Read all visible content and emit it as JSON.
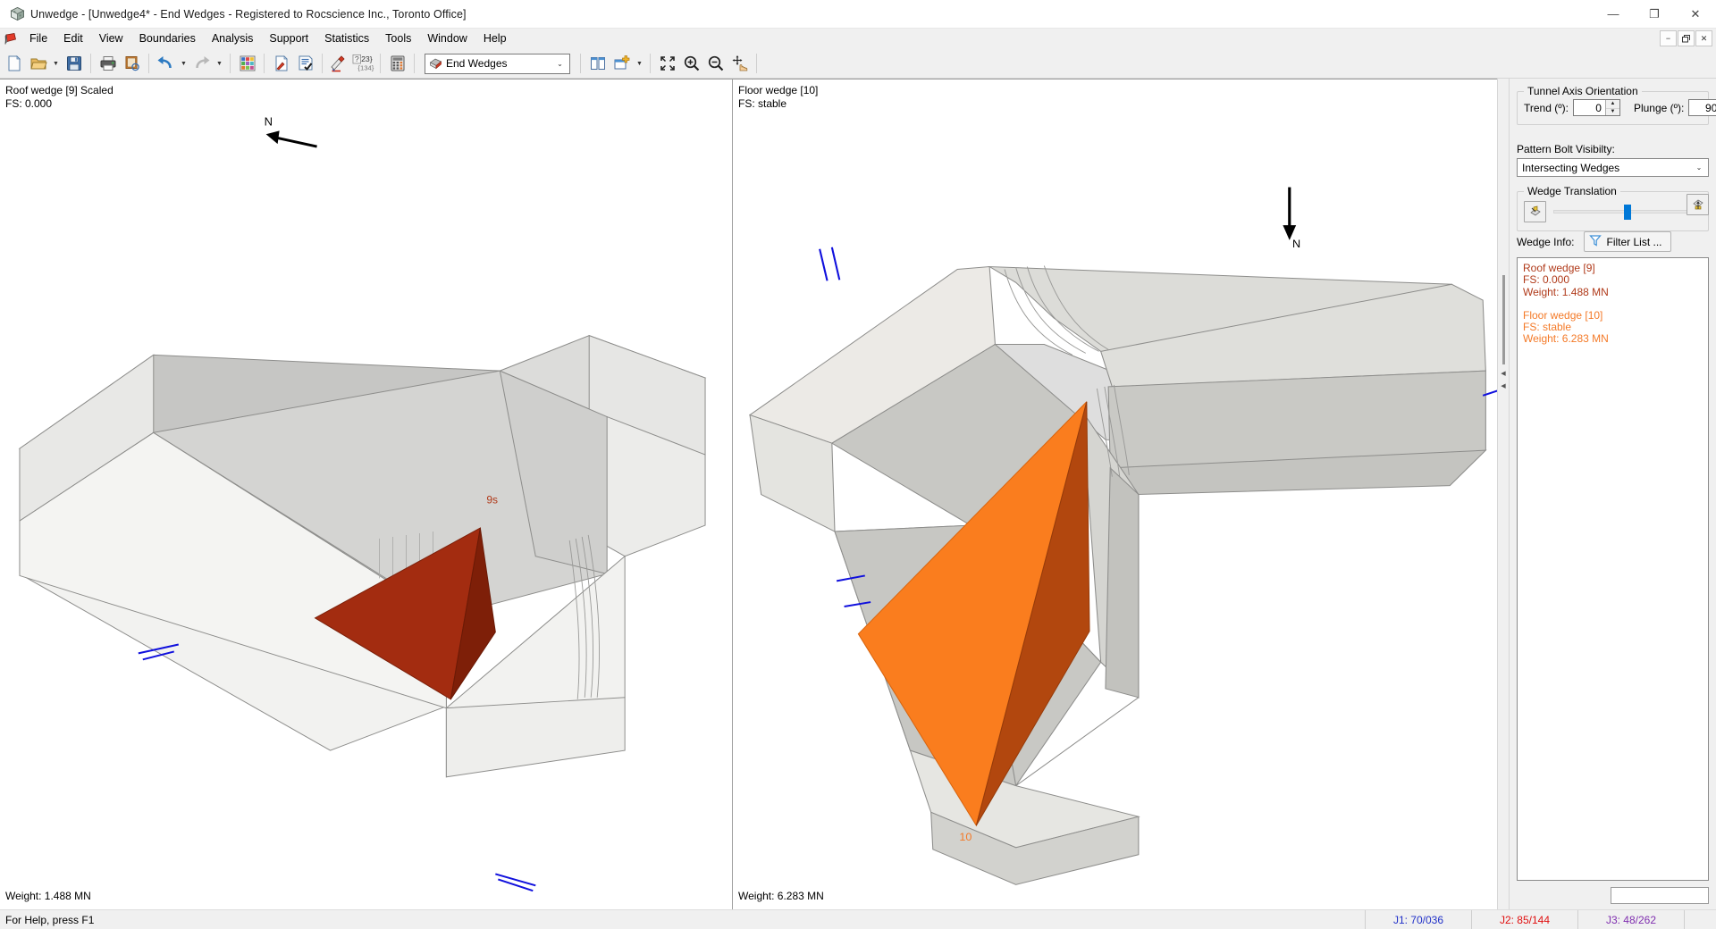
{
  "window": {
    "title": "Unwedge - [Unwedge4* - End Wedges - Registered to Rocscience Inc., Toronto Office]",
    "app_icon": "unwedge-cube-icon",
    "minimize_label": "—",
    "maximize_label": "❐",
    "close_label": "✕",
    "mdi_restore_label": "−",
    "mdi_maximize_label": "❐",
    "mdi_close_label": "✕"
  },
  "menu": {
    "items": [
      {
        "label": "File"
      },
      {
        "label": "Edit"
      },
      {
        "label": "View"
      },
      {
        "label": "Boundaries"
      },
      {
        "label": "Analysis"
      },
      {
        "label": "Support"
      },
      {
        "label": "Statistics"
      },
      {
        "label": "Tools"
      },
      {
        "label": "Window"
      },
      {
        "label": "Help"
      }
    ]
  },
  "toolbar": {
    "buttons": [
      {
        "name": "new-file-icon",
        "tooltip": "New"
      },
      {
        "name": "open-folder-icon",
        "tooltip": "Open"
      },
      {
        "name": "open-dropdown-arrow-icon",
        "tooltip": "Recent Files"
      },
      {
        "name": "save-icon",
        "tooltip": "Save"
      },
      {
        "name": "print-icon",
        "tooltip": "Print"
      },
      {
        "name": "print-preview-icon",
        "tooltip": "Print Preview"
      },
      {
        "name": "undo-icon",
        "tooltip": "Undo"
      },
      {
        "name": "undo-dropdown-arrow-icon",
        "tooltip": "Undo History"
      },
      {
        "name": "redo-icon",
        "tooltip": "Redo"
      },
      {
        "name": "redo-dropdown-arrow-icon",
        "tooltip": "Redo History"
      },
      {
        "name": "color-grid-icon",
        "tooltip": "Display Options"
      },
      {
        "name": "project-settings-icon",
        "tooltip": "Project Settings"
      },
      {
        "name": "input-data-icon",
        "tooltip": "Input Data"
      },
      {
        "name": "joint-properties-icon",
        "tooltip": "Joint Properties"
      },
      {
        "name": "info-viewer-icon",
        "tooltip": "Info Viewer"
      },
      {
        "name": "calculator-icon",
        "tooltip": "Compute"
      }
    ],
    "view_combo": {
      "name": "view-mode-combo",
      "icon": "wedge-cube-icon",
      "value": "End Wedges",
      "caret": "⌄"
    },
    "right_buttons": [
      {
        "name": "tile-windows-icon",
        "tooltip": "Tile Windows"
      },
      {
        "name": "add-window-icon",
        "tooltip": "New Window"
      },
      {
        "name": "add-window-dropdown-arrow-icon",
        "tooltip": "Window Options"
      },
      {
        "name": "zoom-all-icon",
        "tooltip": "Zoom All"
      },
      {
        "name": "zoom-in-icon",
        "tooltip": "Zoom In"
      },
      {
        "name": "zoom-out-icon",
        "tooltip": "Zoom Out"
      },
      {
        "name": "pan-icon",
        "tooltip": "Pan"
      }
    ]
  },
  "viewports": {
    "left": {
      "title": "Roof wedge [9] Scaled",
      "fs": "FS: 0.000",
      "weight": "Weight: 1.488 MN",
      "wedge_tag": "9s",
      "north_label": "N",
      "wedge_color": "#a32c10",
      "wedge_color_shade": "#7e1f08"
    },
    "right": {
      "title": "Floor wedge [10]",
      "fs": "FS: stable",
      "weight": "Weight: 6.283 MN",
      "wedge_tag": "10",
      "north_label": "N",
      "wedge_color": "#fa7d1e",
      "wedge_color_shade": "#b2470e"
    }
  },
  "sidepanel": {
    "tunnel_axis": {
      "title": "Tunnel Axis Orientation",
      "trend_label": "Trend (º):",
      "trend_value": "0",
      "plunge_label": "Plunge (º):",
      "plunge_value": "90",
      "spin_up": "▲",
      "spin_down": "▼"
    },
    "pattern_bolt": {
      "label": "Pattern Bolt Visibilty:",
      "value": "Intersecting Wedges",
      "caret": "⌄"
    },
    "wedge_translation": {
      "title": "Wedge Translation",
      "left_button": "wedge-collapse-icon",
      "right_button": "wedge-expand-icon",
      "slider_percent": 50
    },
    "wedge_info": {
      "label": "Wedge Info:",
      "filter_button": "Filter List ...",
      "filter_icon": "funnel-filter-icon",
      "entries": [
        {
          "name": "Roof wedge [9]",
          "fs": "FS: 0.000",
          "weight": "Weight: 1.488 MN",
          "color": "#b03a1a"
        },
        {
          "name": "Floor wedge [10]",
          "fs": "FS: stable",
          "weight": "Weight: 6.283 MN",
          "color": "#f47a28"
        }
      ]
    }
  },
  "statusbar": {
    "help_text": "For Help, press F1",
    "cells": [
      {
        "label": "J1: 70/036",
        "color": "#2030c8"
      },
      {
        "label": "J2: 85/144",
        "color": "#e01010"
      },
      {
        "label": "J3: 48/262",
        "color": "#8030b0"
      }
    ]
  }
}
